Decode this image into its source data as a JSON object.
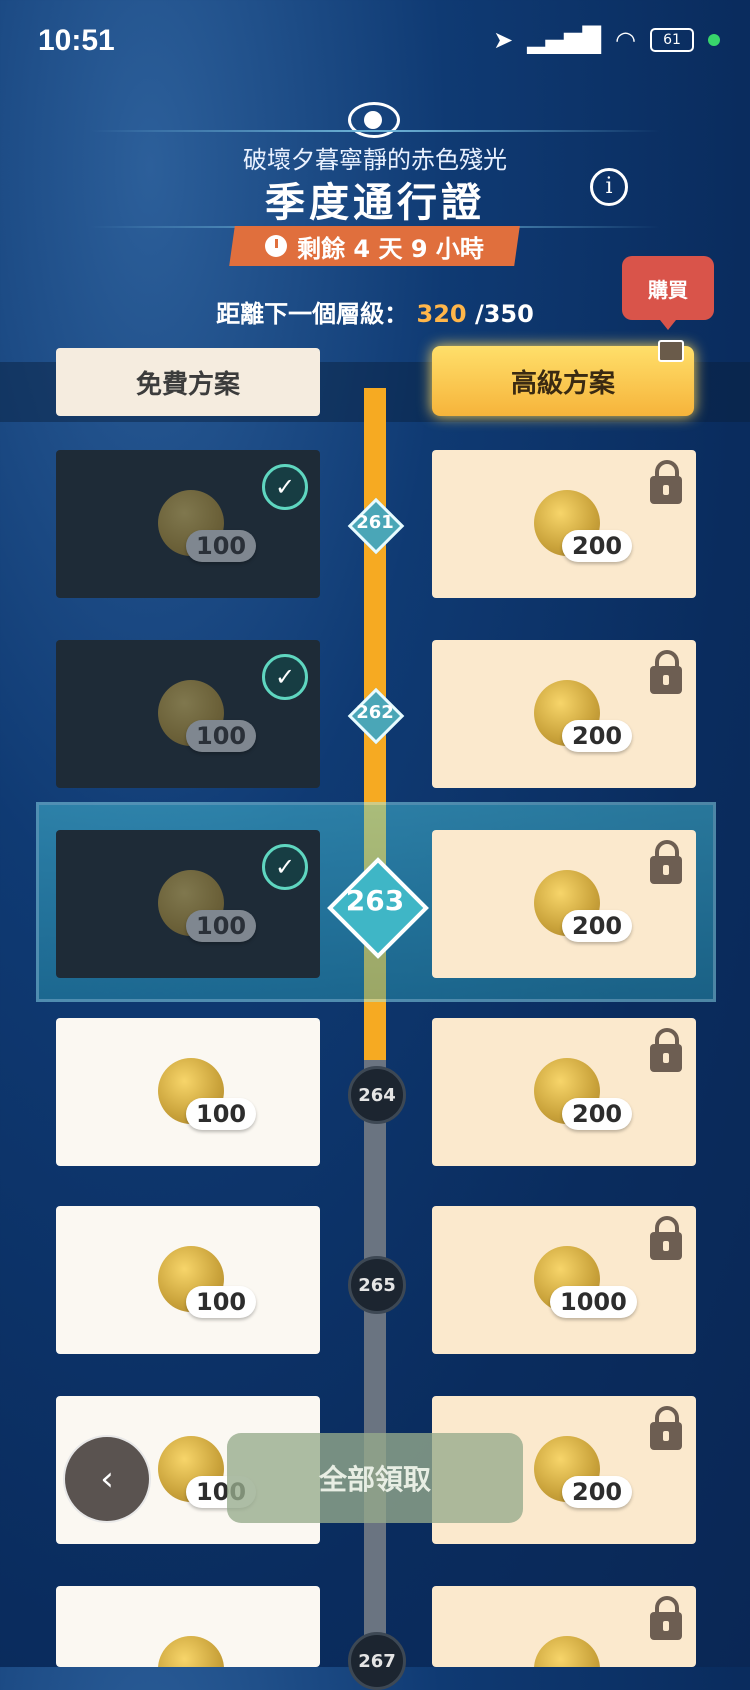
{
  "status_bar": {
    "time": "10:51",
    "battery": "61"
  },
  "header": {
    "subtitle": "破壞夕暮寧靜的赤色殘光",
    "title": "季度通行證",
    "timer": "剩餘 4 天 9 小時",
    "progress_label": "距離下一個層級：",
    "progress_current": "320",
    "progress_total": "/350",
    "buy_label": "購買"
  },
  "plans": {
    "free": "免費方案",
    "premium": "高級方案"
  },
  "rows": [
    {
      "level": "261",
      "free_amount": "100",
      "premium_amount": "200"
    },
    {
      "level": "262",
      "free_amount": "100",
      "premium_amount": "200"
    },
    {
      "level": "263",
      "free_amount": "100",
      "premium_amount": "200"
    },
    {
      "level": "264",
      "free_amount": "100",
      "premium_amount": "200"
    },
    {
      "level": "265",
      "free_amount": "100",
      "premium_amount": "1000"
    },
    {
      "level": "",
      "free_amount": "100",
      "premium_amount": "200"
    },
    {
      "level": "267",
      "free_amount": "",
      "premium_amount": ""
    }
  ],
  "bottom": {
    "back_icon": "chevron-left-icon",
    "claim_all": "全部領取"
  },
  "colors": {
    "accent_gold": "#f6aa22",
    "timer_bg": "#e06f3d",
    "buy_bg": "#d9544a"
  }
}
